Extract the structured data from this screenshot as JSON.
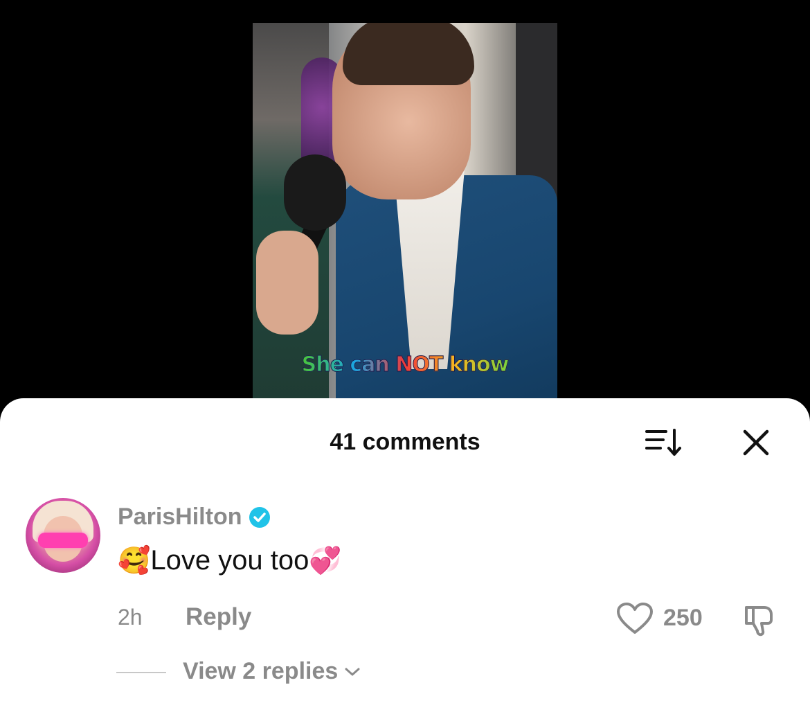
{
  "video": {
    "subtitle": "She can NOT know"
  },
  "comments_panel": {
    "title": "41 comments",
    "sort_icon": "sort-icon",
    "close_icon": "close-icon"
  },
  "comment": {
    "username": "ParisHilton",
    "verified": true,
    "emoji_before": "🥰",
    "text": "Love you too",
    "emoji_after": "💞",
    "time": "2h",
    "reply_label": "Reply",
    "likes": "250",
    "view_replies_label": "View 2 replies"
  },
  "colors": {
    "muted_text": "#8a8a8a",
    "verified_badge": "#20c3e8",
    "sheet_bg": "#ffffff",
    "page_bg": "#000000"
  }
}
